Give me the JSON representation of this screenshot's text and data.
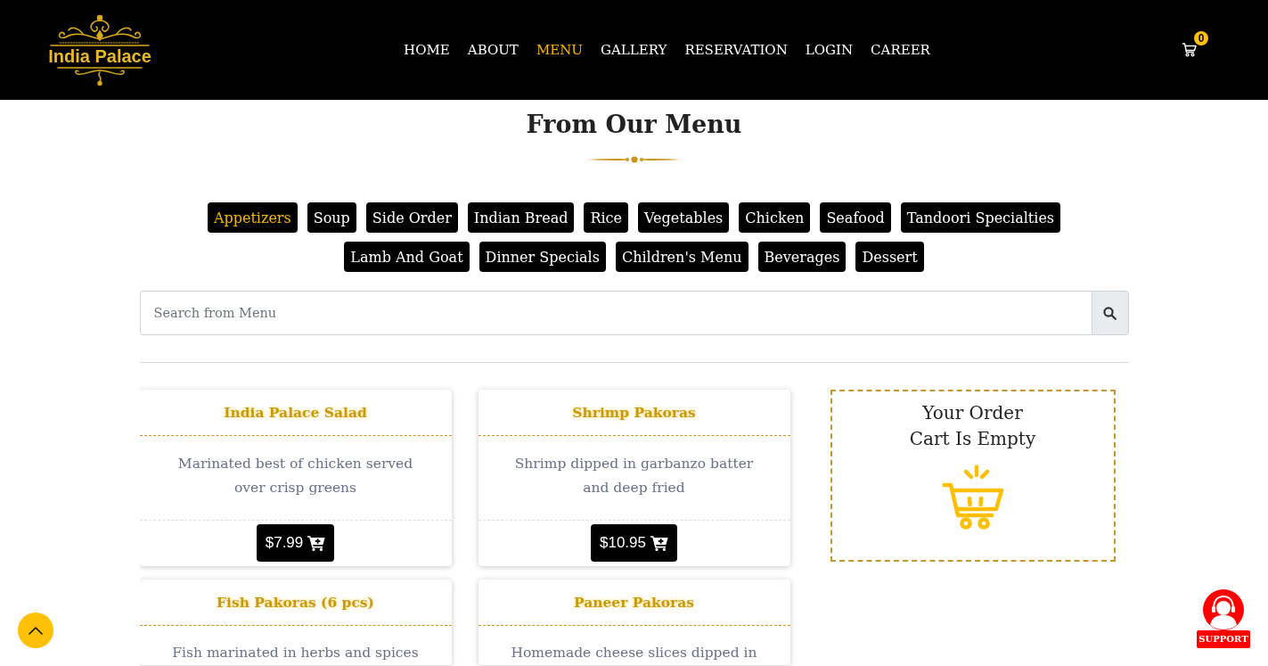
{
  "header": {
    "logo": {
      "text": "India Palace"
    },
    "nav": [
      {
        "label": "HOME",
        "selected": false
      },
      {
        "label": "ABOUT",
        "selected": false
      },
      {
        "label": "MENU",
        "selected": true
      },
      {
        "label": "GALLERY",
        "selected": false
      },
      {
        "label": "RESERVATION",
        "selected": false
      },
      {
        "label": "LOGIN",
        "selected": false
      },
      {
        "label": "CAREER",
        "selected": false
      }
    ],
    "cart": {
      "count": "0"
    }
  },
  "section": {
    "title": "From Our Menu"
  },
  "category_rows": [
    {
      "items": [
        {
          "label": "Appetizers",
          "selected": true
        },
        {
          "label": "Soup",
          "selected": false
        },
        {
          "label": "Side Order",
          "selected": false
        },
        {
          "label": "Indian Bread",
          "selected": false
        },
        {
          "label": "Rice",
          "selected": false
        },
        {
          "label": "Vegetables",
          "selected": false
        },
        {
          "label": "Chicken",
          "selected": false
        },
        {
          "label": "Seafood",
          "selected": false
        },
        {
          "label": "Tandoori Specialties",
          "selected": false
        }
      ]
    },
    {
      "items": [
        {
          "label": "Lamb And Goat",
          "selected": false
        },
        {
          "label": "Dinner Specials",
          "selected": false
        },
        {
          "label": "Children's Menu",
          "selected": false
        },
        {
          "label": "Beverages",
          "selected": false
        },
        {
          "label": "Dessert",
          "selected": false
        }
      ]
    }
  ],
  "search": {
    "placeholder": "Search from Menu"
  },
  "menu_items": [
    {
      "name": "India Palace Salad",
      "description": "Marinated best of chicken served over crisp greens",
      "price": "$7.99"
    },
    {
      "name": "Shrimp Pakoras",
      "description": "Shrimp dipped in garbanzo batter and deep fried",
      "price": "$10.95"
    },
    {
      "name": "Fish Pakoras (6 pcs)",
      "description": "Fish marinated in herbs and spices"
    },
    {
      "name": "Paneer Pakoras",
      "description": "Homemade cheese slices dipped in"
    }
  ],
  "cart_panel": {
    "title_lines": [
      "Your Order",
      "Cart Is Empty"
    ]
  },
  "support": {
    "label": "SUPPORT"
  }
}
